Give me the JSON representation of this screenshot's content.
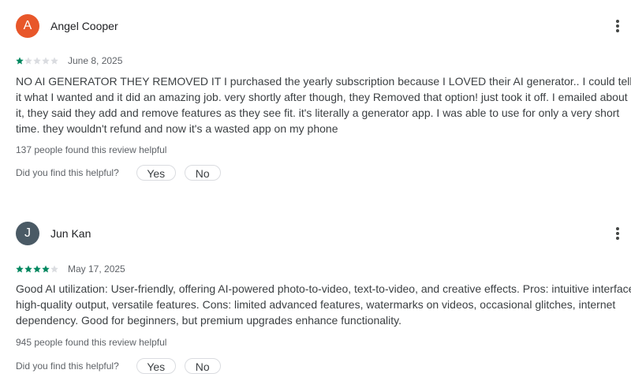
{
  "colors": {
    "star_filled": "#01875f",
    "star_empty": "#dadce0"
  },
  "reviews": [
    {
      "author": "Angel Cooper",
      "avatar_letter": "A",
      "avatar_color": "#e8572a",
      "rating": 1,
      "date": "June 8, 2025",
      "text": "NO AI GENERATOR THEY REMOVED IT I purchased the yearly subscription because I LOVED their AI generator.. I could tell it what I wanted and it did an amazing job. very shortly after though, they Removed that option! just took it off. I emailed about it, they said they add and remove features as they see fit. it's literally a generator app. I was able to use for only a very short time. they wouldn't refund and now it's a wasted app on my phone",
      "helpful_count": "137 people found this review helpful",
      "helpful_question": "Did you find this helpful?",
      "yes_label": "Yes",
      "no_label": "No",
      "more_icon": "more-vertical-icon"
    },
    {
      "author": "Jun Kan",
      "avatar_letter": "J",
      "avatar_color": "#4a5a65",
      "rating": 4,
      "date": "May 17, 2025",
      "text": "Good AI utilization: User-friendly, offering AI-powered photo-to-video, text-to-video, and creative effects. Pros: intuitive interface, high-quality output, versatile features. Cons: limited advanced features, watermarks on videos, occasional glitches, internet dependency. Good for beginners, but premium upgrades enhance functionality.",
      "helpful_count": "945 people found this review helpful",
      "helpful_question": "Did you find this helpful?",
      "yes_label": "Yes",
      "no_label": "No",
      "more_icon": "more-vertical-icon"
    }
  ]
}
